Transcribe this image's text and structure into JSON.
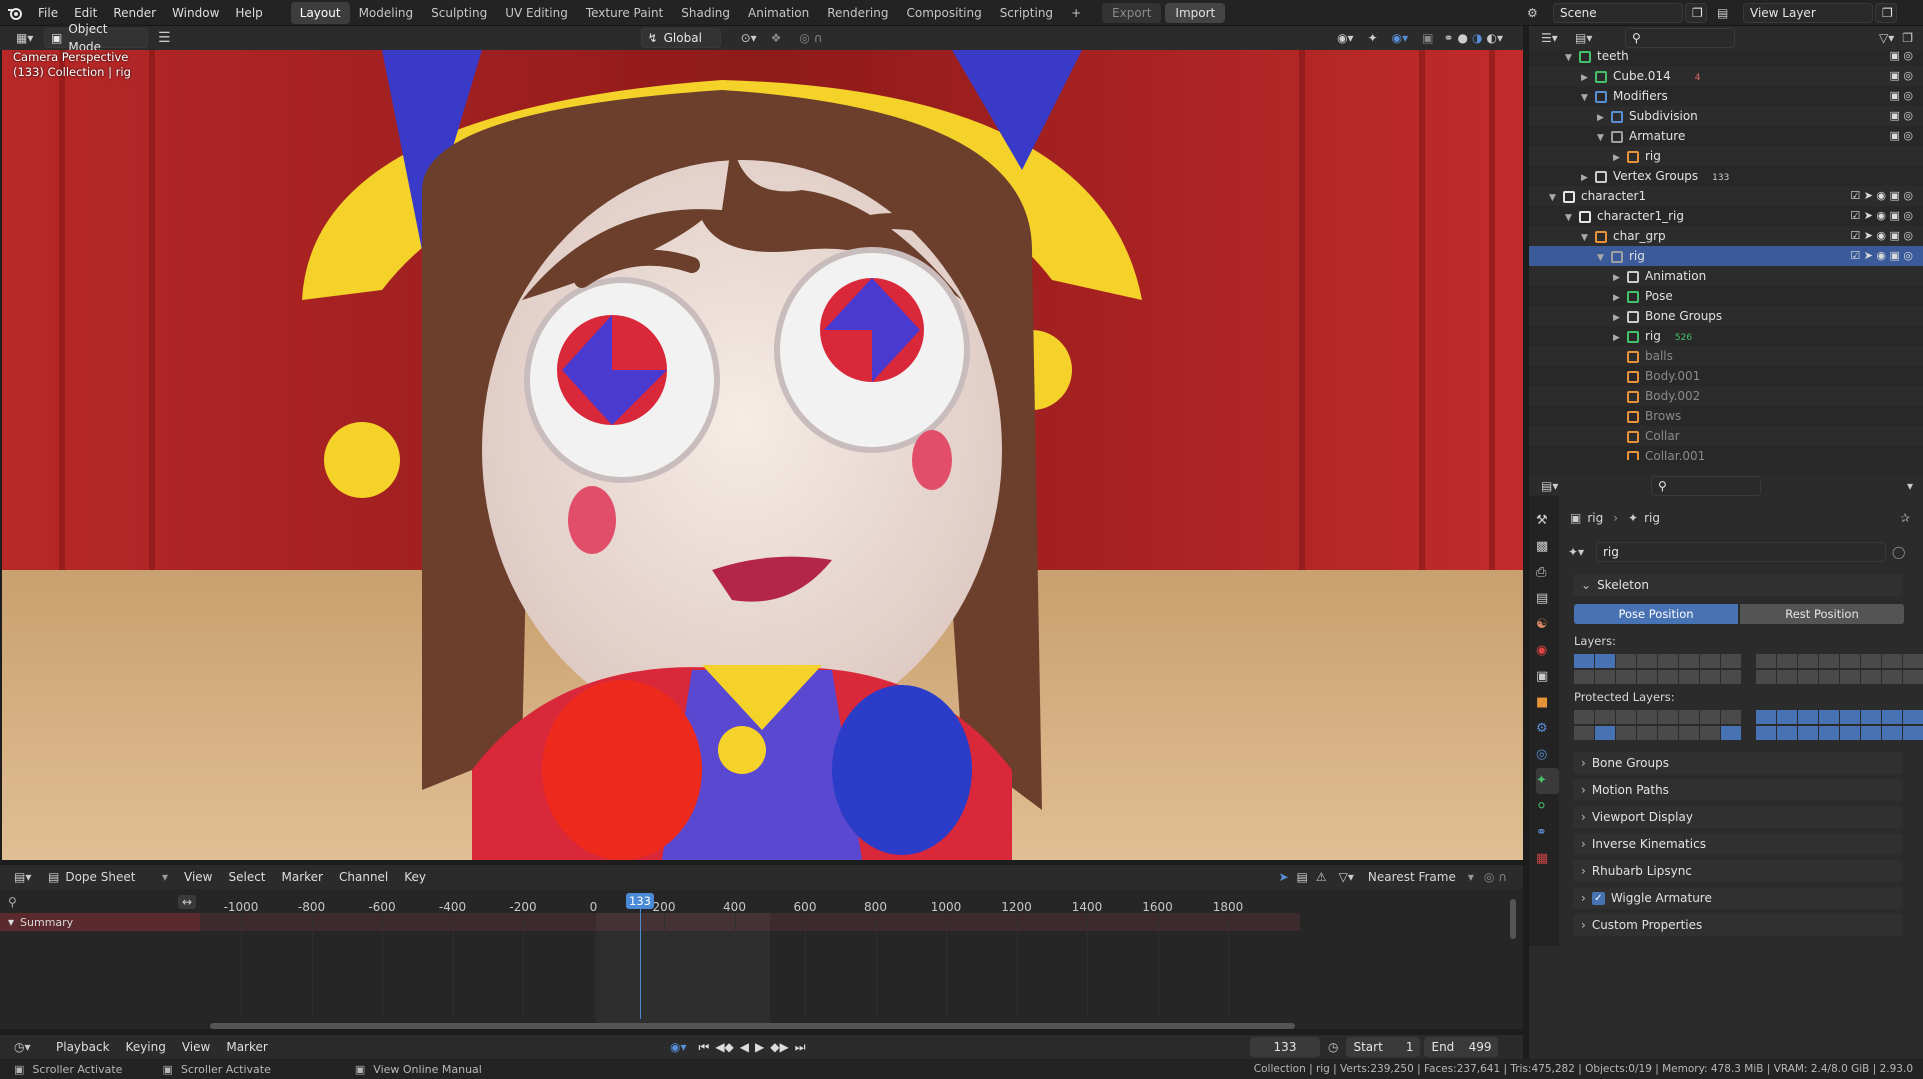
{
  "topbar": {
    "menus": [
      "File",
      "Edit",
      "Render",
      "Window",
      "Help"
    ],
    "workspaces": [
      "Layout",
      "Modeling",
      "Sculpting",
      "UV Editing",
      "Texture Paint",
      "Shading",
      "Animation",
      "Rendering",
      "Compositing",
      "Scripting"
    ],
    "active_workspace": "Layout",
    "plus": "+",
    "export_label": "Export",
    "import_label": "Import",
    "scene": "Scene",
    "view_layer": "View Layer"
  },
  "viewport": {
    "mode": "Object Mode",
    "transform": "Global",
    "overlay_line1": "Camera Perspective",
    "overlay_line2": "(133) Collection | rig"
  },
  "outliner": {
    "rows": [
      {
        "label": "teeth",
        "indent": 2,
        "icon": "mesh"
      },
      {
        "label": "Cube.014",
        "indent": 3,
        "icon": "mesh"
      },
      {
        "label": "Modifiers",
        "indent": 3,
        "icon": "wrench"
      },
      {
        "label": "Subdivision",
        "indent": 4,
        "icon": "modifier"
      },
      {
        "label": "Armature",
        "indent": 4,
        "icon": "armature"
      },
      {
        "label": "rig",
        "indent": 5,
        "icon": "object"
      },
      {
        "label": "Vertex Groups",
        "indent": 3,
        "icon": "groups"
      },
      {
        "label": "character1",
        "indent": 1,
        "icon": "collection"
      },
      {
        "label": "character1_rig",
        "indent": 2,
        "icon": "collection"
      },
      {
        "label": "char_grp",
        "indent": 3,
        "icon": "empty"
      },
      {
        "label": "rig",
        "indent": 4,
        "icon": "armature"
      },
      {
        "label": "Animation",
        "indent": 5,
        "icon": "anim"
      },
      {
        "label": "Pose",
        "indent": 5,
        "icon": "pose"
      },
      {
        "label": "Bone Groups",
        "indent": 5,
        "icon": "bonegroups"
      },
      {
        "label": "rig",
        "indent": 5,
        "icon": "armature-data"
      },
      {
        "label": "balls",
        "indent": 5,
        "icon": "vertex"
      },
      {
        "label": "Body.001",
        "indent": 5,
        "icon": "vertex"
      },
      {
        "label": "Body.002",
        "indent": 5,
        "icon": "vertex"
      },
      {
        "label": "Brows",
        "indent": 5,
        "icon": "vertex"
      },
      {
        "label": "Collar",
        "indent": 5,
        "icon": "vertex"
      },
      {
        "label": "Collar.001",
        "indent": 5,
        "icon": "vertex"
      }
    ],
    "badge_133": "133",
    "badge_4": "4",
    "badge_526": "526"
  },
  "properties": {
    "breadcrumb_object": "rig",
    "breadcrumb_data": "rig",
    "data_name": "rig",
    "skeleton_label": "Skeleton",
    "pose_position": "Pose Position",
    "rest_position": "Rest Position",
    "layers_label": "Layers:",
    "protected_layers_label": "Protected Layers:",
    "panels": [
      "Bone Groups",
      "Motion Paths",
      "Viewport Display",
      "Inverse Kinematics",
      "Rhubarb Lipsync",
      "Wiggle Armature",
      "Custom Properties"
    ]
  },
  "dopesheet": {
    "editor": "Dope Sheet",
    "menus": [
      "View",
      "Select",
      "Marker",
      "Channel",
      "Key"
    ],
    "snap": "Nearest Frame",
    "ticks": [
      "-1000",
      "-800",
      "-600",
      "-400",
      "-200",
      "0",
      "200",
      "400",
      "600",
      "800",
      "1000",
      "1200",
      "1400",
      "1600",
      "1800"
    ],
    "current_frame": "133",
    "summary": "Summary"
  },
  "timeline": {
    "menus": [
      "Playback",
      "Keying",
      "View",
      "Marker"
    ],
    "frame": "133",
    "start_label": "Start",
    "start": "1",
    "end_label": "End",
    "end": "499"
  },
  "status": {
    "left1": "Scroller Activate",
    "left2": "Scroller Activate",
    "left3": "View Online Manual",
    "right": "Collection | rig | Verts:239,250 | Faces:237,641 | Tris:475,282 | Objects:0/19 | Memory: 478.3 MiB | VRAM: 2.4/8.0 GiB | 2.93.0"
  },
  "colors": {
    "selection": "#3a5a99",
    "accent": "#4772b3",
    "playhead": "#4b8ad6"
  }
}
